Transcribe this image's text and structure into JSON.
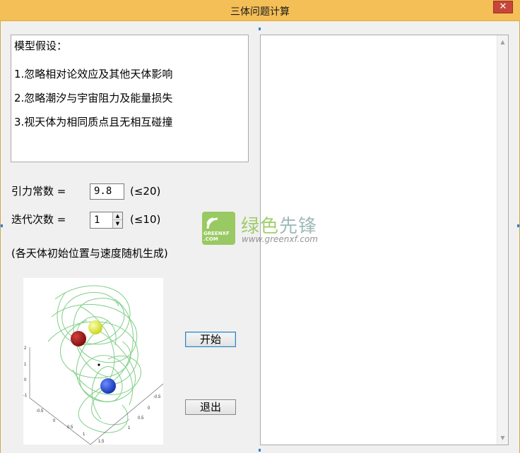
{
  "window": {
    "title": "三体问题计算",
    "close_label": "✕"
  },
  "assumptions": {
    "heading": "模型假设：",
    "items": [
      "1.忽略相对论效应及其他天体影响",
      "2.忽略潮汐与宇宙阻力及能量损失",
      "3.视天体为相同质点且无相互碰撞"
    ]
  },
  "gravity": {
    "label": "引力常数  =",
    "value": "9.8",
    "hint": "(≤20)"
  },
  "iterations": {
    "label": "迭代次数  =",
    "value": "1",
    "hint": "(≤10)"
  },
  "note": "(各天体初始位置与速度随机生成)",
  "buttons": {
    "start": "开始",
    "exit": "退出"
  },
  "plot": {
    "body_colors": {
      "red": "#8e1212",
      "yellow": "#e6f02a",
      "blue": "#1740d6"
    },
    "orbit_color": "#7fcf86",
    "axis_labels": [
      "2",
      "1",
      "0",
      "-1",
      "-0.5",
      "0",
      "0.5",
      "1",
      "1.5",
      "1",
      "0.5",
      "0",
      "-0.5"
    ]
  },
  "watermark": {
    "logo_text": "GREENXF .COM",
    "cn_first": "绿色",
    "cn_second": "先锋",
    "url": "www.greenxf.com"
  }
}
